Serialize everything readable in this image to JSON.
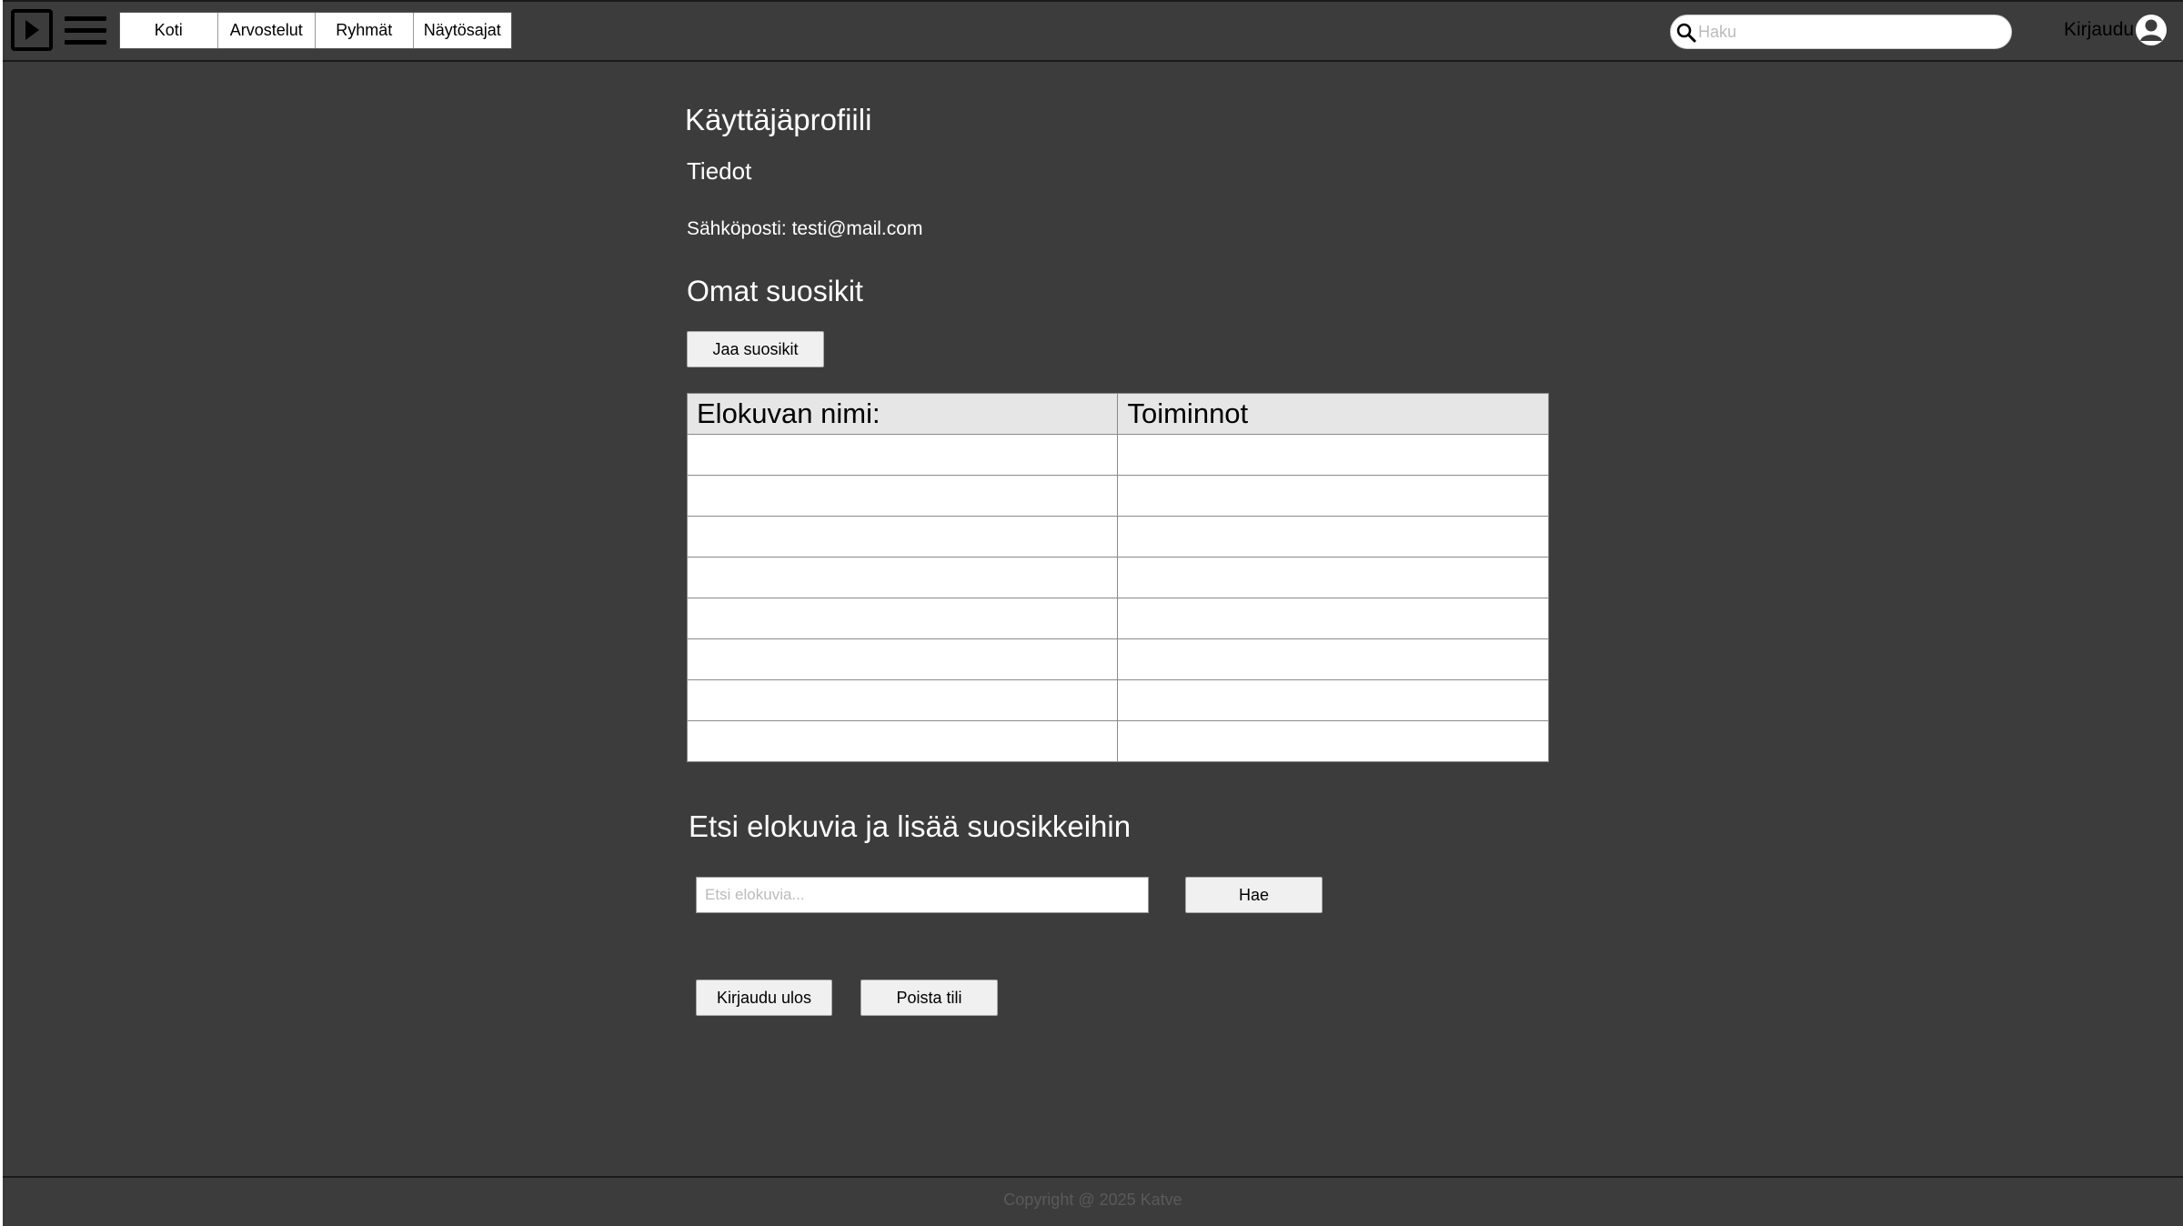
{
  "nav": {
    "tabs": [
      "Koti",
      "Arvostelut",
      "Ryhmät",
      "Näytösajat"
    ]
  },
  "header": {
    "search_placeholder": "Haku",
    "login_label": "Kirjaudu"
  },
  "profile": {
    "title": "Käyttäjäprofiili",
    "info_heading": "Tiedot",
    "email_label": "Sähköposti:",
    "email_value": "testi@mail.com"
  },
  "favorites": {
    "heading": "Omat suosikit",
    "share_button": "Jaa suosikit",
    "columns": [
      "Elokuvan nimi:",
      "Toiminnot"
    ],
    "rows": [
      [
        "",
        ""
      ],
      [
        "",
        ""
      ],
      [
        "",
        ""
      ],
      [
        "",
        ""
      ],
      [
        "",
        ""
      ],
      [
        "",
        ""
      ],
      [
        "",
        ""
      ],
      [
        "",
        ""
      ]
    ]
  },
  "movie_search": {
    "heading": "Etsi elokuvia ja lisää suosikkeihin",
    "placeholder": "Etsi elokuvia...",
    "search_button": "Hae"
  },
  "account": {
    "logout_button": "Kirjaudu ulos",
    "delete_button": "Poista tili"
  },
  "footer": {
    "copyright": "Copyright @ 2025 Katve"
  }
}
